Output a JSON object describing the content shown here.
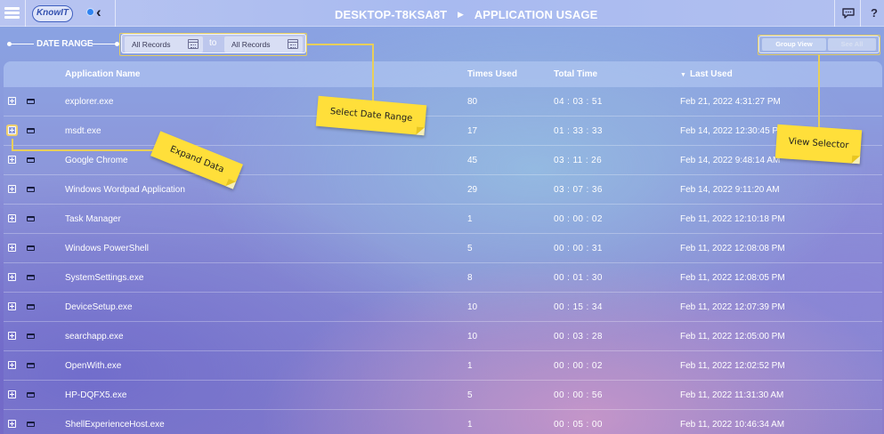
{
  "app": {
    "logo_text": "KnowIT",
    "device_name": "DESKTOP-T8KSA8T",
    "page_title": "APPLICATION USAGE"
  },
  "topbar": {
    "menu_icon": "hamburger-menu-icon",
    "collapse_icon": "chevron-left-icon",
    "chat_icon": "chat-bubble-icon",
    "help_label": "?"
  },
  "date_range": {
    "label": "DATE RANGE",
    "from_value": "All Records",
    "to_label": "to",
    "to_value": "All Records"
  },
  "view_toggle": {
    "group_view_label": "Group View",
    "see_all_label": "See All"
  },
  "table": {
    "columns": {
      "name": "Application Name",
      "times": "Times Used",
      "total": "Total Time",
      "last": "Last Used"
    },
    "sort_indicator": "▼",
    "rows": [
      {
        "name": "explorer.exe",
        "times": "80",
        "total": "04 : 03 : 51",
        "last": "Feb 21, 2022 4:31:27 PM"
      },
      {
        "name": "msdt.exe",
        "times": "17",
        "total": "01 : 33 : 33",
        "last": "Feb 14, 2022 12:30:45 PM"
      },
      {
        "name": "Google Chrome",
        "times": "45",
        "total": "03 : 11 : 26",
        "last": "Feb 14, 2022 9:48:14 AM"
      },
      {
        "name": "Windows Wordpad Application",
        "times": "29",
        "total": "03 : 07 : 36",
        "last": "Feb 14, 2022 9:11:20 AM"
      },
      {
        "name": "Task Manager",
        "times": "1",
        "total": "00 : 00 : 02",
        "last": "Feb 11, 2022 12:10:18 PM"
      },
      {
        "name": "Windows PowerShell",
        "times": "5",
        "total": "00 : 00 : 31",
        "last": "Feb 11, 2022 12:08:08 PM"
      },
      {
        "name": "SystemSettings.exe",
        "times": "8",
        "total": "00 : 01 : 30",
        "last": "Feb 11, 2022 12:08:05 PM"
      },
      {
        "name": "DeviceSetup.exe",
        "times": "10",
        "total": "00 : 15 : 34",
        "last": "Feb 11, 2022 12:07:39 PM"
      },
      {
        "name": "searchapp.exe",
        "times": "10",
        "total": "00 : 03 : 28",
        "last": "Feb 11, 2022 12:05:00 PM"
      },
      {
        "name": "OpenWith.exe",
        "times": "1",
        "total": "00 : 00 : 02",
        "last": "Feb 11, 2022 12:02:52 PM"
      },
      {
        "name": "HP-DQFX5.exe",
        "times": "5",
        "total": "00 : 00 : 56",
        "last": "Feb 11, 2022 11:31:30 AM"
      },
      {
        "name": "ShellExperienceHost.exe",
        "times": "1",
        "total": "00 : 05 : 00",
        "last": "Feb 11, 2022 10:46:34 AM"
      }
    ]
  },
  "callouts": {
    "select_date_range": "Select Date Range",
    "expand_data": "Expand Data",
    "view_selector": "View Selector"
  }
}
